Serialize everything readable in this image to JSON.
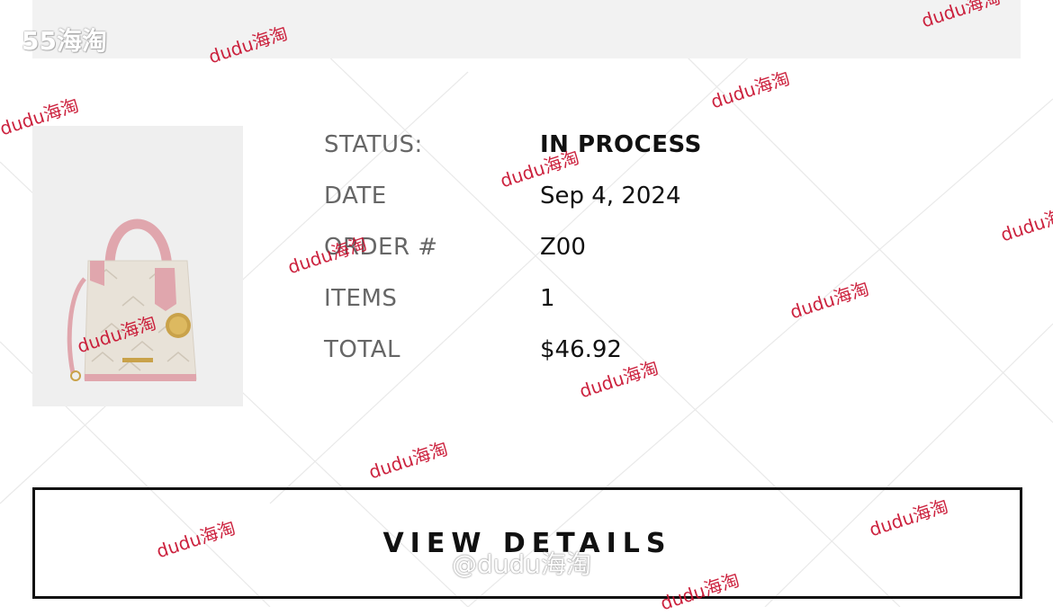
{
  "site_mark": "55海淘",
  "watermark_text": "dudu海淘",
  "center_watermark": "@dudu海淘",
  "order": {
    "status_label": "STATUS:",
    "status_value": "IN PROCESS",
    "date_label": "DATE",
    "date_value": "Sep 4, 2024",
    "order_label": "ORDER #",
    "order_value": "Z00",
    "items_label": "ITEMS",
    "items_value": "1",
    "total_label": "TOTAL",
    "total_value": "$46.92"
  },
  "cta": {
    "label": "VIEW DETAILS"
  },
  "colors": {
    "watermark": "#c8102e",
    "bag_body": "#e8e2d8",
    "bag_trim": "#e0a6ad",
    "hardware": "#c9a24a"
  }
}
